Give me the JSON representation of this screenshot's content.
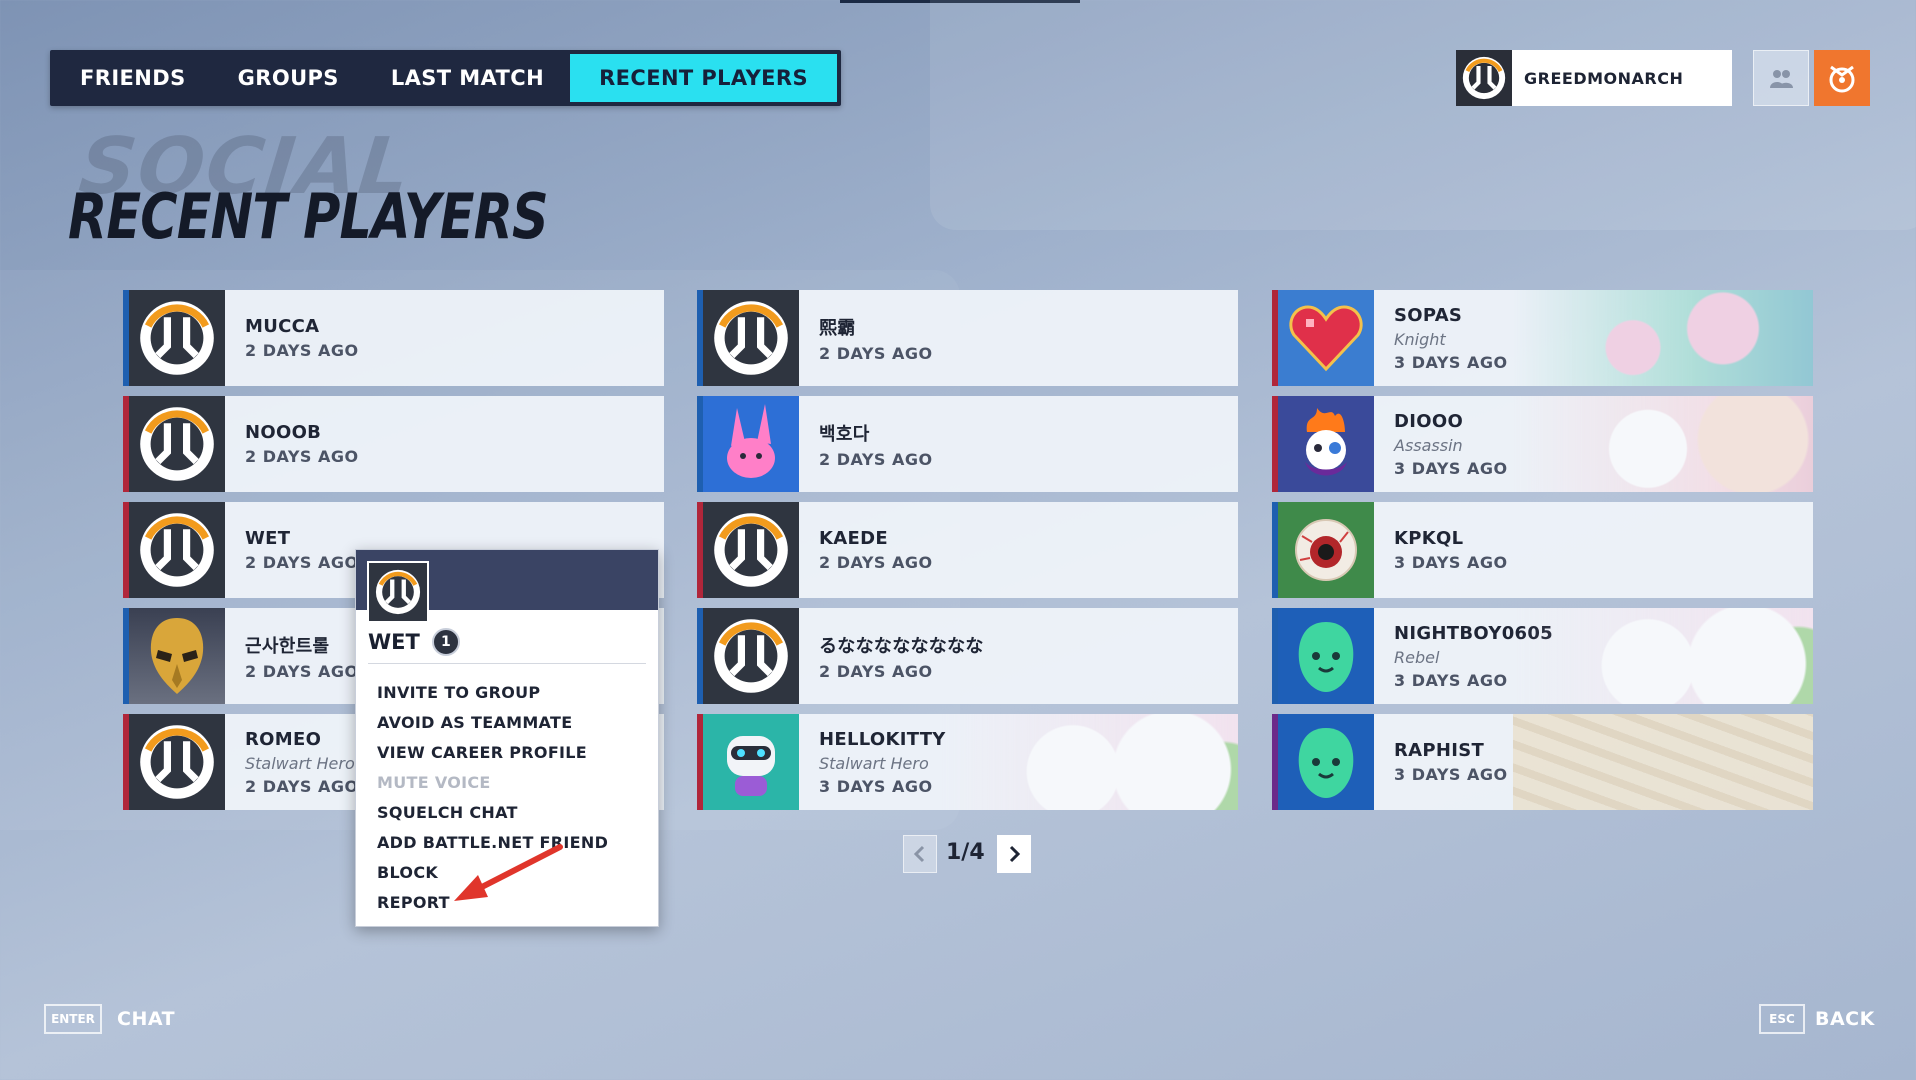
{
  "tabs": [
    "FRIENDS",
    "GROUPS",
    "LAST MATCH",
    "RECENT PLAYERS"
  ],
  "active_tab": "RECENT PLAYERS",
  "profile": {
    "name": "GREEDMONARCH"
  },
  "header": {
    "ghost_title": "SOCIAL",
    "title": "RECENT PLAYERS"
  },
  "colors": {
    "accent": "#2ae0f0",
    "orange": "#f0762e",
    "dark": "#1f2840"
  },
  "players": [
    {
      "name": "MUCCA",
      "title": "",
      "ago": "2 DAYS AGO",
      "avatar": "overwatch-logo-icon",
      "stripe": "#1e5fb0"
    },
    {
      "name": "NOOOB",
      "title": "",
      "ago": "2 DAYS AGO",
      "avatar": "overwatch-logo-icon",
      "stripe": "#b0263a"
    },
    {
      "name": "WET",
      "title": "",
      "ago": "2 DAYS AGO",
      "avatar": "overwatch-logo-icon",
      "stripe": "#b0263a"
    },
    {
      "name": "근사한트롤",
      "title": "",
      "ago": "2 DAYS AGO",
      "avatar": "gold-mask-icon",
      "stripe": "#1e5fb0"
    },
    {
      "name": "ROMEO",
      "title": "Stalwart Hero",
      "ago": "2 DAYS AGO",
      "avatar": "overwatch-logo-icon",
      "stripe": "#b0263a"
    },
    {
      "name": "熙霸",
      "title": "",
      "ago": "2 DAYS AGO",
      "avatar": "overwatch-logo-icon",
      "stripe": "#1e5fb0"
    },
    {
      "name": "백호다",
      "title": "",
      "ago": "2 DAYS AGO",
      "avatar": "pink-bunny-icon",
      "stripe": "#1e5fb0"
    },
    {
      "name": "KAEDE",
      "title": "",
      "ago": "2 DAYS AGO",
      "avatar": "overwatch-logo-icon",
      "stripe": "#b0263a"
    },
    {
      "name": "るなななななななな",
      "title": "",
      "ago": "2 DAYS AGO",
      "avatar": "overwatch-logo-icon",
      "stripe": "#1e5fb0"
    },
    {
      "name": "HELLOKITTY",
      "title": "Stalwart Hero",
      "ago": "3 DAYS AGO",
      "avatar": "raccoon-robot-icon",
      "stripe": "#b0263a"
    },
    {
      "name": "SOPAS",
      "title": "Knight",
      "ago": "3 DAYS AGO",
      "avatar": "pixel-heart-icon",
      "stripe": "#b0263a"
    },
    {
      "name": "DIOOO",
      "title": "Assassin",
      "ago": "3 DAYS AGO",
      "avatar": "flame-clown-icon",
      "stripe": "#b0263a"
    },
    {
      "name": "KPKQL",
      "title": "",
      "ago": "3 DAYS AGO",
      "avatar": "eyeball-icon",
      "stripe": "#1e5fb0"
    },
    {
      "name": "NIGHTBOY0605",
      "title": "Rebel",
      "ago": "3 DAYS AGO",
      "avatar": "green-ghost-icon",
      "stripe": "#1e5fb0"
    },
    {
      "name": "RAPHIST",
      "title": "",
      "ago": "3 DAYS AGO",
      "avatar": "green-ghost-icon",
      "stripe": "#6b2a8a"
    }
  ],
  "context_menu": {
    "player": "WET",
    "badge": "1",
    "items": [
      "INVITE TO GROUP",
      "AVOID AS TEAMMATE",
      "VIEW CAREER PROFILE",
      "MUTE VOICE",
      "SQUELCH CHAT",
      "ADD BATTLE.NET FRIEND",
      "BLOCK",
      "REPORT"
    ],
    "disabled_item": "MUTE VOICE"
  },
  "pagination": {
    "label": "1/4"
  },
  "footer": {
    "chat_key": "ENTER",
    "chat_label": "CHAT",
    "back_key": "ESC",
    "back_label": "BACK"
  }
}
